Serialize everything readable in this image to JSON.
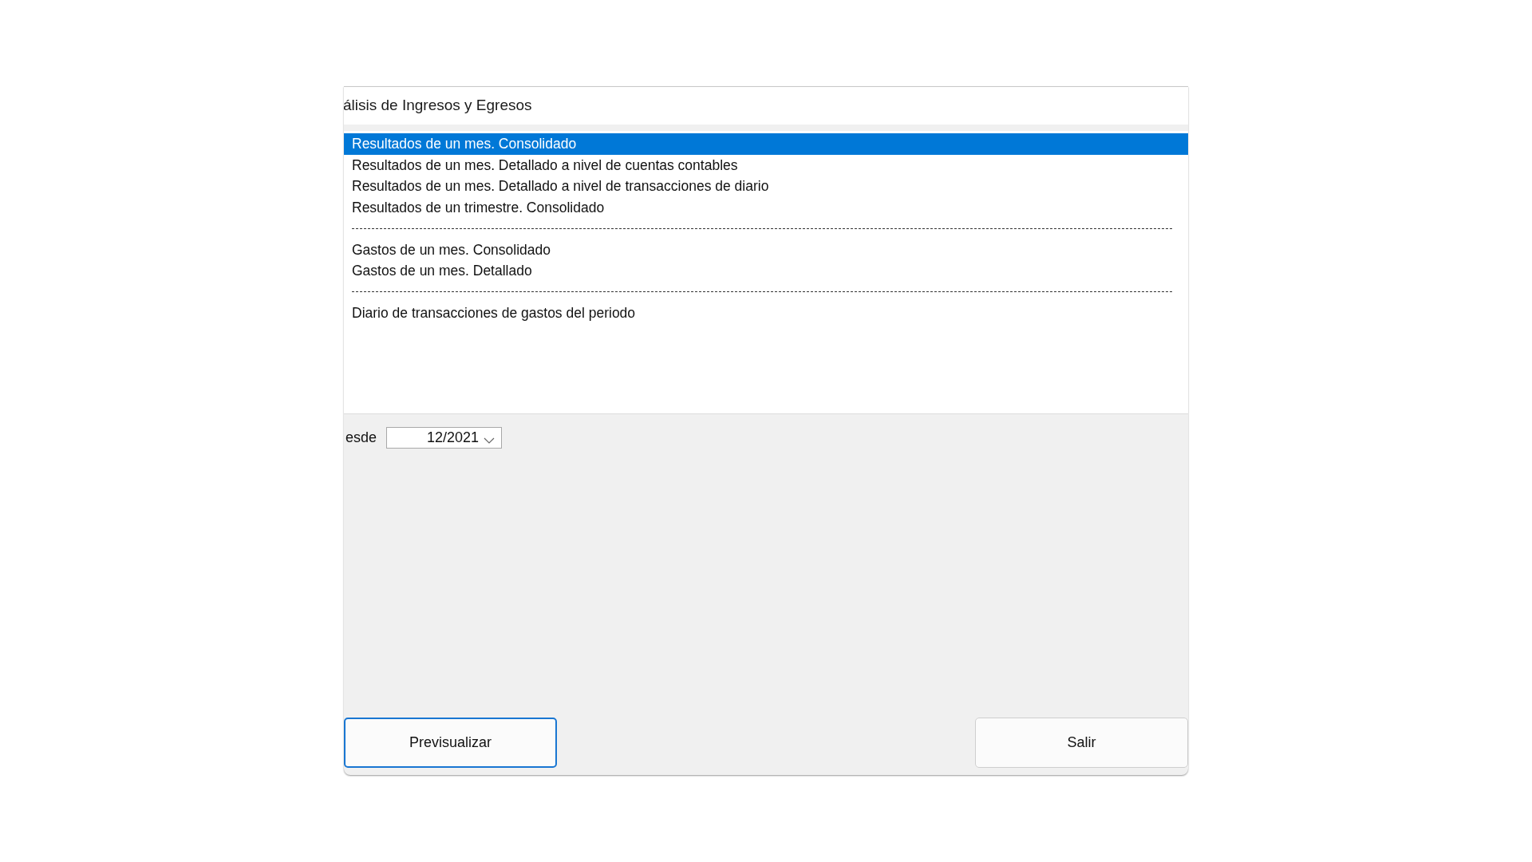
{
  "window": {
    "title": "álisis de Ingresos y Egresos"
  },
  "reports": [
    {
      "kind": "item",
      "label": "Resultados de un mes. Consolidado",
      "selected": true
    },
    {
      "kind": "item",
      "label": "Resultados de un mes. Detallado a nivel de cuentas contables",
      "selected": false
    },
    {
      "kind": "item",
      "label": "Resultados de un mes. Detallado a nivel de transacciones de diario",
      "selected": false
    },
    {
      "kind": "item",
      "label": "Resultados de un trimestre. Consolidado",
      "selected": false
    },
    {
      "kind": "separator"
    },
    {
      "kind": "item",
      "label": "Gastos de un mes. Consolidado",
      "selected": false
    },
    {
      "kind": "item",
      "label": "Gastos de un mes. Detallado",
      "selected": false
    },
    {
      "kind": "separator"
    },
    {
      "kind": "item",
      "label": "Diario de transacciones de gastos del periodo",
      "selected": false
    }
  ],
  "period": {
    "label": "esde",
    "value": "12/2021"
  },
  "buttons": [
    {
      "label": "Previsualizar",
      "focused": true
    },
    {
      "label": "Salir",
      "focused": false
    }
  ]
}
